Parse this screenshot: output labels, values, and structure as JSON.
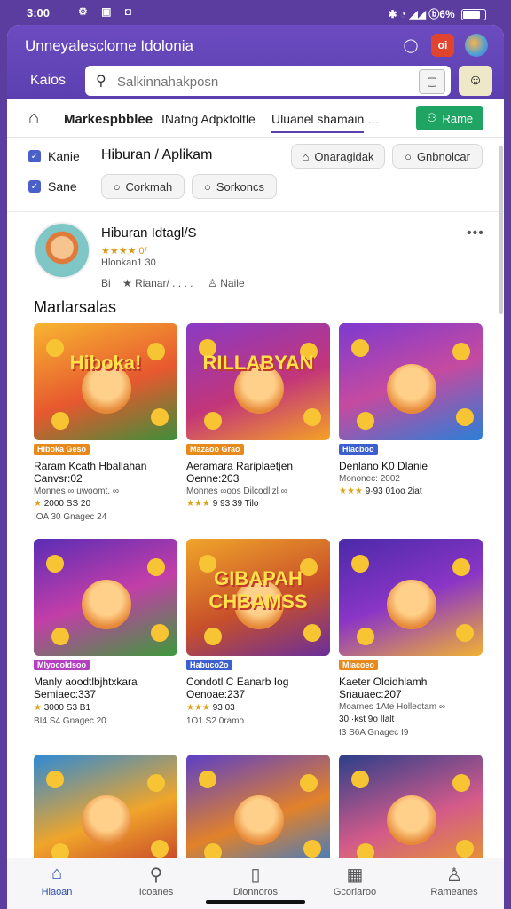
{
  "status": {
    "time": "3:00",
    "left_icons": "⚙ ▣ ◘",
    "right_text": "✱ ◔ ◢◢ ⓑ6%"
  },
  "header": {
    "title": "Unneyalesclome Idolonia",
    "notif_badge": "oi",
    "location": "Kaios",
    "search": {
      "placeholder": "Salkinnahakposn"
    }
  },
  "tabs": {
    "market": "Markespbblee",
    "apps": "INatng Adpkfoltle",
    "entertain": "Uluanel shamain",
    "extra": "…",
    "green_button": "Rame"
  },
  "filters": {
    "check1": "Kanie",
    "check2": "Sane",
    "title": "Hiburan / Aplikam",
    "chips": [
      "Onaragidak",
      "Gnbnolcar",
      "Corkmah",
      "Sorkoncs"
    ]
  },
  "profile": {
    "name": "Hiburan Idtagl/S",
    "rating": "★★★★ 0/",
    "sub": "Hlonkan1 30",
    "meta_a": "Bi",
    "meta_b": "Rianar/ . . . .",
    "meta_c": "Naile"
  },
  "section_title": "Marlarsalas",
  "cards": [
    {
      "art": "Hiboka!",
      "tag": "Hiboka Geso",
      "tag_color": "#e8891b",
      "title": "Raram Kcath Hballahan Canvsr:02",
      "sub": "Monnes ∞ uwoomt. ∞",
      "stars": "★",
      "rating": "2000 SS 20",
      "foot": "IOA 30 Gnagec 24",
      "bg": "linear-gradient(160deg,#f7b531,#e7582f 55%,#3c8f3a)"
    },
    {
      "art": "RILLABYAN",
      "tag": "Mazaoo Grao",
      "tag_color": "#e8891b",
      "title": "Aeramara Rariplaetjen Oenne:203",
      "sub": "Monnes ∞oos Dilcodlizl ∞",
      "stars": "★★★",
      "rating": "9 93 39 Tilo",
      "foot": "",
      "bg": "linear-gradient(160deg,#8a3bc5,#c2357a 55%,#f4a226)"
    },
    {
      "art": "",
      "tag": "Hlacboo",
      "tag_color": "#3b5fd1",
      "title": "Denlano K0 Dlanie",
      "sub": "Mononec: 2002",
      "stars": "★★★",
      "rating": "9·93 01oo 2iat",
      "foot": "",
      "bg": "linear-gradient(160deg,#7d3ad0,#c54aa0 50%,#2a7fd6)"
    },
    {
      "art": "",
      "tag": "Mlyocoldsoo",
      "tag_color": "#b43fc2",
      "title": "Manly aoodtlbjhtxkara Semiaec:337",
      "sub": "",
      "stars": "★",
      "rating": "3000 S3 B1",
      "foot": "BI4 S4 Gnagec 20",
      "bg": "linear-gradient(160deg,#5a2db5,#c23ea8 50%,#3d9a3a)"
    },
    {
      "art": "GIBAPAH CHBAMSS",
      "tag": "Habuco2o",
      "tag_color": "#3b5fd1",
      "title": "Condotl C Eanarb Iog Oenoae:237",
      "sub": "",
      "stars": "★★★",
      "rating": "93 03",
      "foot": "1O1 S2 0ramo",
      "bg": "linear-gradient(160deg,#f0a52a,#c8502a 55%,#6a2e9a)"
    },
    {
      "art": "",
      "tag": "Miacoeo",
      "tag_color": "#e8891b",
      "title": "Kaeter Oloidhlamh Snauaec:207",
      "sub": "Moarnes 1Ate Holleotam ∞",
      "stars": "",
      "rating": "30 ·kst 9o Ilalt",
      "foot": "I3 S6A Gnagec I9",
      "bg": "linear-gradient(160deg,#4a2aa8,#8a35c6 50%,#f1b233)"
    },
    {
      "art": "",
      "tag": "",
      "tag_color": "#e8891b",
      "title": "",
      "sub": "",
      "stars": "",
      "rating": "",
      "foot": "",
      "bg": "linear-gradient(160deg,#2d8ad6,#f0a52a 55%,#c23a2a)"
    },
    {
      "art": "",
      "tag": "",
      "tag_color": "#e8891b",
      "title": "",
      "sub": "",
      "stars": "",
      "rating": "",
      "foot": "",
      "bg": "linear-gradient(160deg,#5b3fc8,#e2822a 55%,#2d7bd6)"
    },
    {
      "art": "",
      "tag": "",
      "tag_color": "#e8891b",
      "title": "",
      "sub": "",
      "stars": "",
      "rating": "",
      "foot": "",
      "bg": "linear-gradient(160deg,#2a3f8a,#d35a8a 55%,#e89a2a)"
    }
  ],
  "nav": [
    {
      "icon": "home-icon",
      "label": "Hlaoan"
    },
    {
      "icon": "search-icon",
      "label": "Icoanes"
    },
    {
      "icon": "phone-icon",
      "label": "Dlonnoros"
    },
    {
      "icon": "grid-icon",
      "label": "Gcoriaroo"
    },
    {
      "icon": "person-icon",
      "label": "Rameanes"
    }
  ],
  "colors": {
    "accent": "#5b3fb0",
    "green": "#1fa463",
    "active_nav": "#2c4fb5"
  }
}
